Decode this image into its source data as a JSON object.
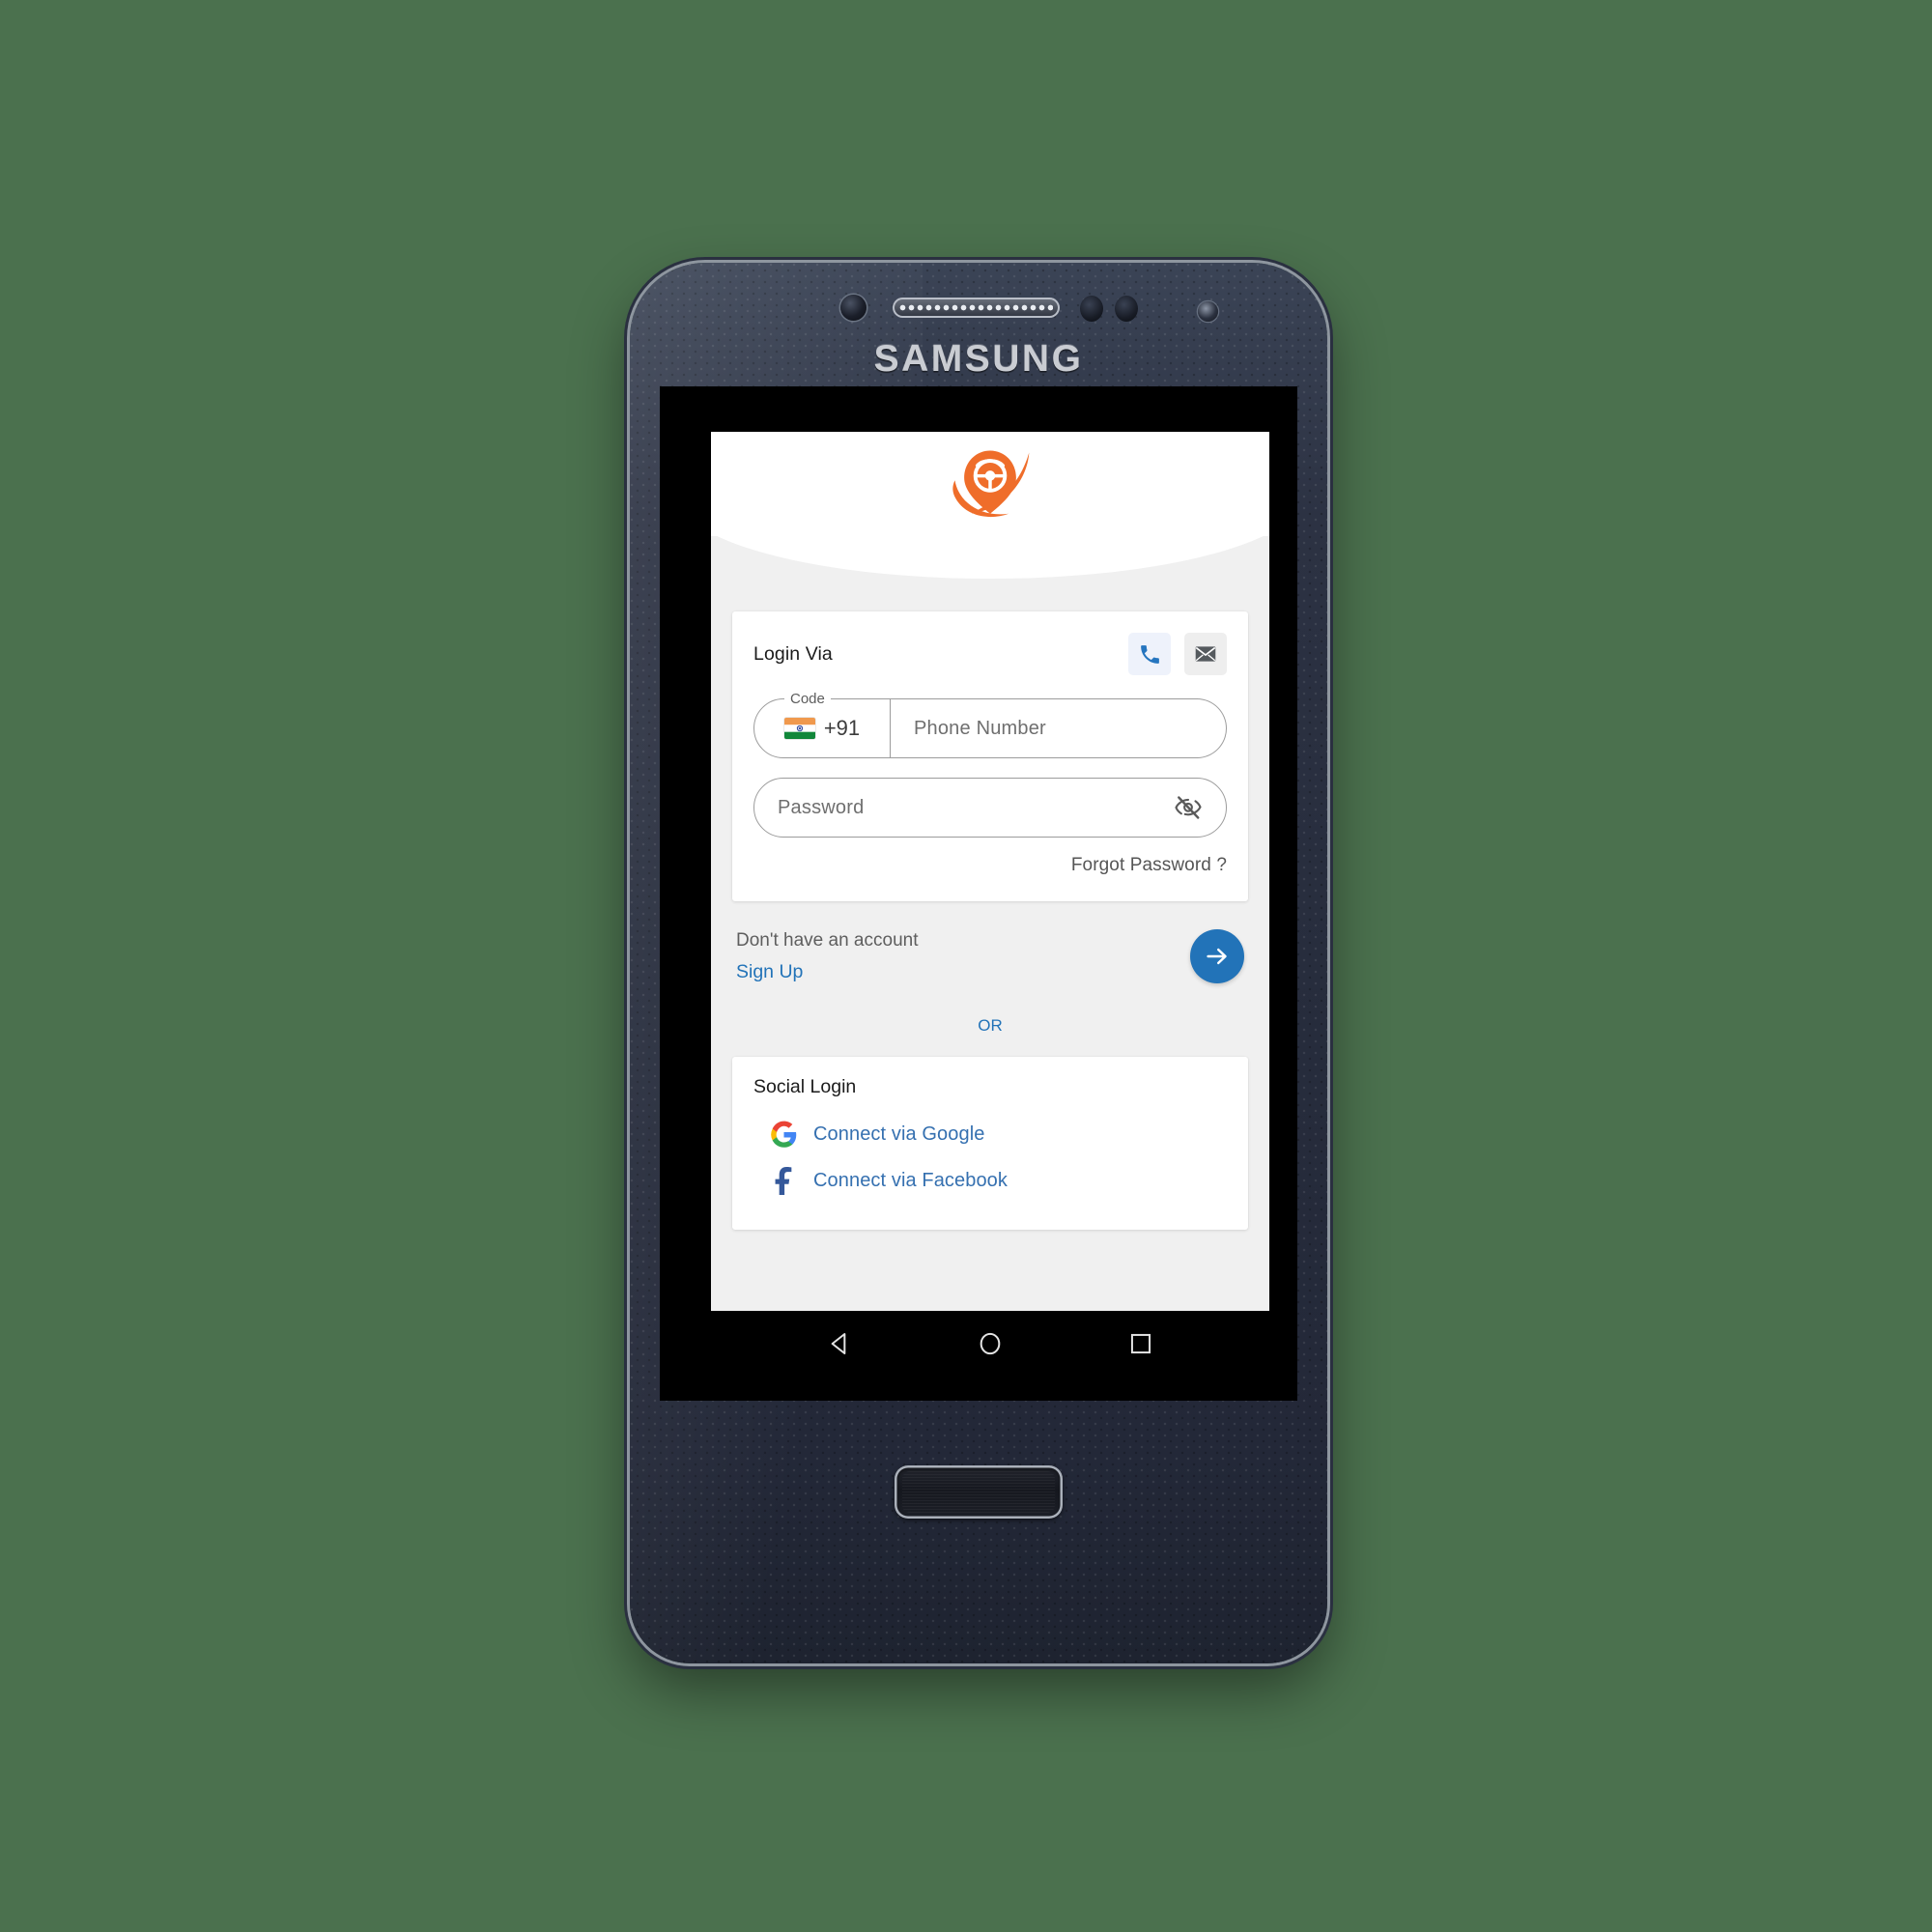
{
  "device": {
    "brand": "SAMSUNG",
    "nav_bar": {
      "back_icon": "back-triangle-icon",
      "home_icon": "home-circle-icon",
      "recents_icon": "recents-square-icon"
    }
  },
  "app": {
    "logo_icon": "steering-wheel-pin-logo",
    "login_card": {
      "title": "Login Via",
      "methods": [
        {
          "id": "phone",
          "icon": "phone-icon",
          "selected": true
        },
        {
          "id": "email",
          "icon": "envelope-icon",
          "selected": false
        }
      ],
      "country_code": {
        "label": "Code",
        "flag_icon": "india-flag-icon",
        "value": "+91"
      },
      "phone_placeholder": "Phone Number",
      "password_placeholder": "Password",
      "password_toggle_icon": "eye-off-icon",
      "forgot_password": "Forgot Password ?"
    },
    "signup": {
      "prompt": "Don't have an account",
      "link": "Sign Up",
      "submit_icon": "arrow-right-icon"
    },
    "divider": "OR",
    "social_card": {
      "title": "Social Login",
      "options": [
        {
          "label": "Connect via Google",
          "icon": "google-g-icon"
        },
        {
          "label": "Connect via Facebook",
          "icon": "facebook-f-icon"
        }
      ]
    }
  },
  "colors": {
    "background": "#4b714e",
    "brand_orange": "#ef6d2a",
    "accent_blue": "#2273b8",
    "link_blue": "#3570b0",
    "screen_bg": "#f0f0f0"
  }
}
